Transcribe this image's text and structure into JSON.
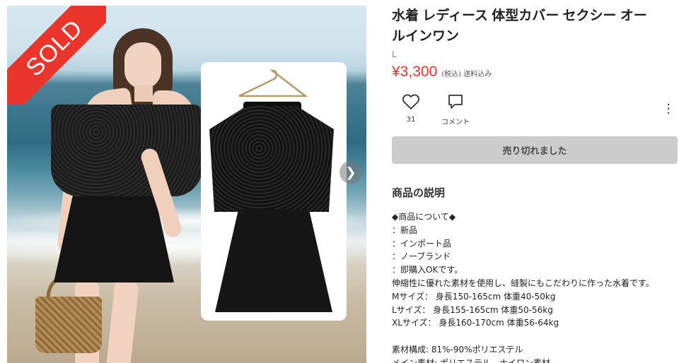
{
  "product": {
    "title_line1": "水着 レディース 体型カバー セクシー オー",
    "title_line2": "ルインワン",
    "size": "L",
    "price": "¥3,300",
    "tax_note": "(税込) 送料込み"
  },
  "badge": {
    "sold": "SOLD",
    "color": "#ea352d"
  },
  "gallery": {
    "next_icon": "chevron-right-icon"
  },
  "actions": {
    "like_count": "31",
    "comment_label": "コメント",
    "more_icon": "vertical-dots-icon"
  },
  "buttons": {
    "sold_out": "売り切れました"
  },
  "description": {
    "heading": "商品の説明",
    "lines": [
      "◆商品について◆",
      "：新品",
      "：インポート品",
      "：ノーブランド",
      "：即購入OKです。",
      "伸縮性に優れた素材を使用し、縫製にもこだわりに作った水着です。",
      "Mサイズ： 身長150-165cm 体重40-50kg",
      "Lサイズ： 身長155-165cm 体重50-56kg",
      "XLサイズ： 身長160-170cm 体重56-64kg",
      "",
      "素材構成: 81%-90%ポリエステル",
      "メイン素材: ポリエステル、ナイロン素材"
    ]
  }
}
